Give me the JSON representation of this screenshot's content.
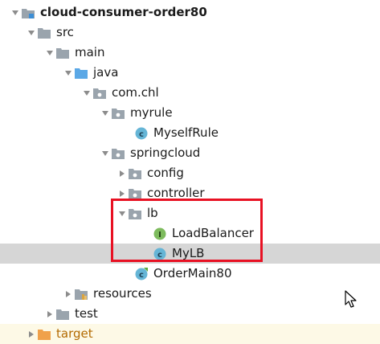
{
  "tree": {
    "project": "cloud-consumer-order80",
    "src": "src",
    "main": "main",
    "java": "java",
    "pkg_root": "com.chl",
    "myrule": "myrule",
    "myself_rule": "MyselfRule",
    "springcloud": "springcloud",
    "config": "config",
    "controller": "controller",
    "lb": "lb",
    "load_balancer": "LoadBalancer",
    "mylb": "MyLB",
    "order_main": "OrderMain80",
    "resources": "resources",
    "test": "test",
    "target": "target"
  },
  "icons": {
    "class_icon": "class-c",
    "interface_icon": "interface-i",
    "package_icon": "package-folder",
    "folder_icon": "folder"
  },
  "colors": {
    "selection": "#d6d6d6",
    "highlight_border": "#e81123",
    "class_badge": "#65b5d6",
    "interface_badge": "#7dbb5d",
    "folder_gray": "#9aa4ad",
    "source_folder_blue": "#5ba8e6",
    "excluded_folder": "#f0a14a",
    "excluded_text": "#b36a00"
  }
}
